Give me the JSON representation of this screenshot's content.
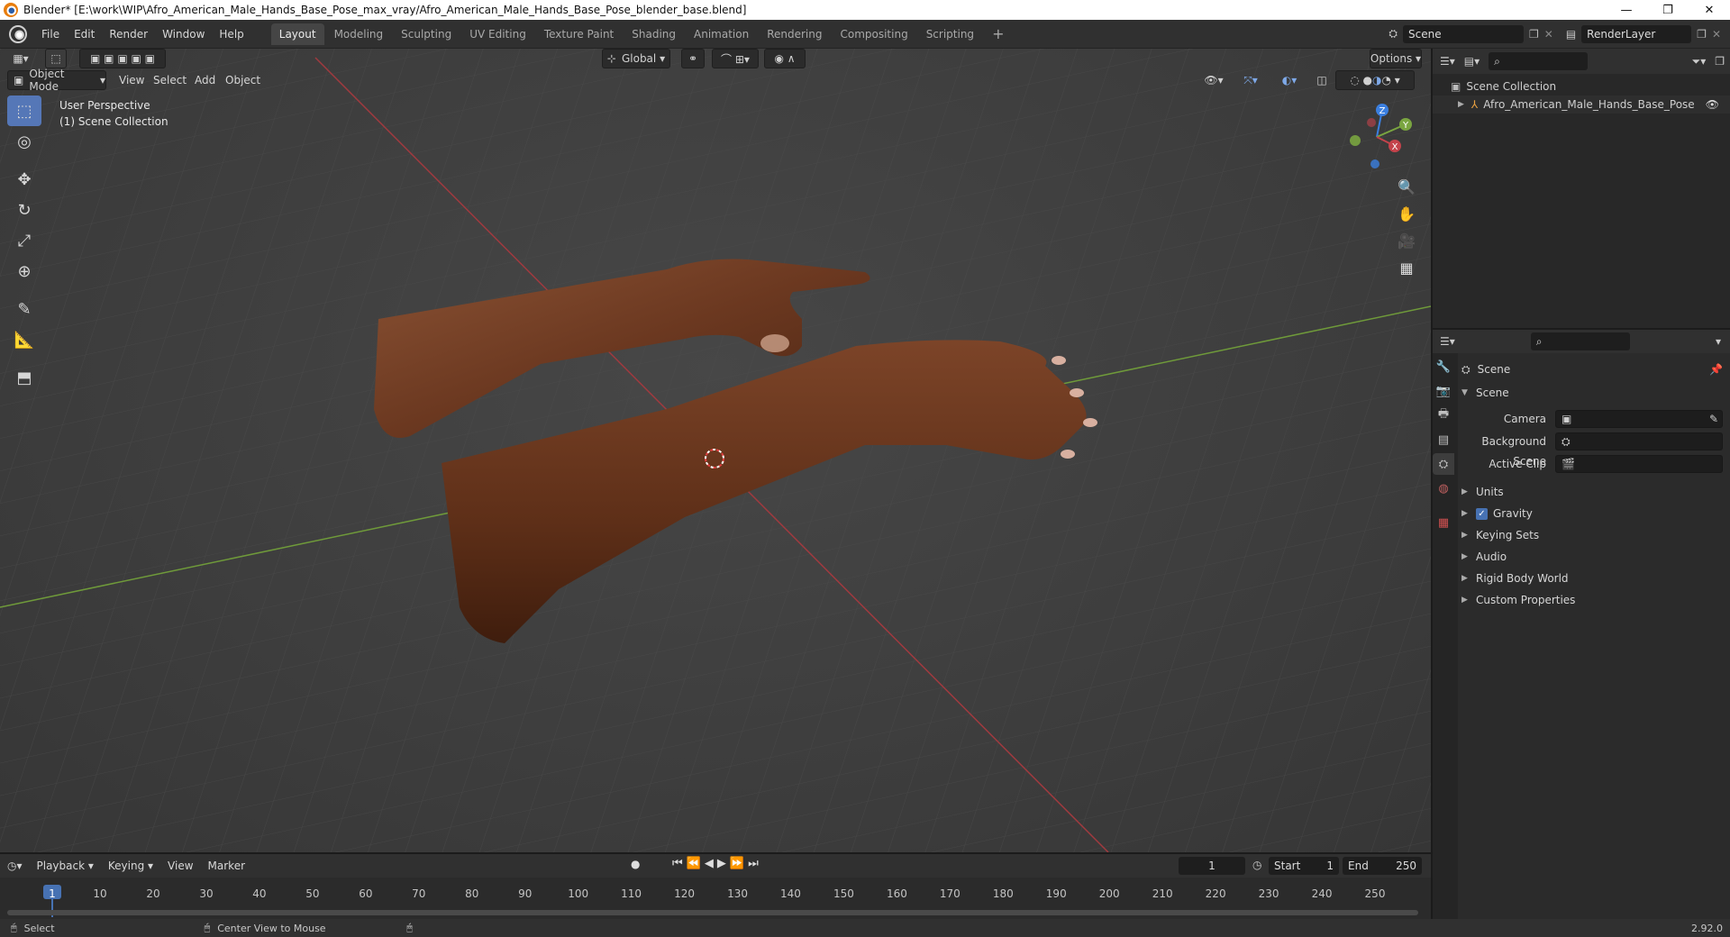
{
  "window": {
    "title": "Blender* [E:\\work\\WIP\\Afro_American_Male_Hands_Base_Pose_max_vray/Afro_American_Male_Hands_Base_Pose_blender_base.blend]",
    "minimize": "—",
    "maximize": "❐",
    "close": "✕"
  },
  "menu": [
    "File",
    "Edit",
    "Render",
    "Window",
    "Help"
  ],
  "workspaces": [
    "Layout",
    "Modeling",
    "Sculpting",
    "UV Editing",
    "Texture Paint",
    "Shading",
    "Animation",
    "Rendering",
    "Compositing",
    "Scripting"
  ],
  "active_workspace": "Layout",
  "scene_selector": {
    "value": "Scene"
  },
  "view_layer": {
    "value": "RenderLayer"
  },
  "viewport": {
    "mode": "Object Mode",
    "menus": [
      "View",
      "Select",
      "Add",
      "Object"
    ],
    "transform_orientation": "Global",
    "options_label": "Options",
    "overlay_line1": "User Perspective",
    "overlay_line2": "(1) Scene Collection",
    "gizmo": {
      "x": "X",
      "y": "Y",
      "z": "Z"
    }
  },
  "outliner": {
    "root": "Scene Collection",
    "items": [
      {
        "label": "Afro_American_Male_Hands_Base_Pose"
      }
    ]
  },
  "properties": {
    "context_title": "Scene",
    "panel_title": "Scene",
    "fields": [
      {
        "label": "Camera",
        "value": ""
      },
      {
        "label": "Background Scene",
        "value": ""
      },
      {
        "label": "Active Clip",
        "value": ""
      }
    ],
    "sections": [
      "Units",
      "Gravity",
      "Keying Sets",
      "Audio",
      "Rigid Body World",
      "Custom Properties"
    ],
    "gravity_checked": true
  },
  "timeline": {
    "menus": [
      "Playback",
      "Keying",
      "View",
      "Marker"
    ],
    "current_frame": "1",
    "start_label": "Start",
    "start_value": "1",
    "end_label": "End",
    "end_value": "250",
    "ticks": [
      "1",
      "10",
      "20",
      "30",
      "40",
      "50",
      "60",
      "70",
      "80",
      "90",
      "100",
      "110",
      "120",
      "130",
      "140",
      "150",
      "160",
      "170",
      "180",
      "190",
      "200",
      "210",
      "220",
      "230",
      "240",
      "250"
    ]
  },
  "statusbar": {
    "left": "Select",
    "middle": "Center View to Mouse",
    "version": "2.92.0"
  },
  "colors": {
    "accent": "#5577b7",
    "x_axis": "#c4434b",
    "y_axis": "#7aa540",
    "z_axis": "#3b7fe0",
    "skin": "#6a3820"
  }
}
